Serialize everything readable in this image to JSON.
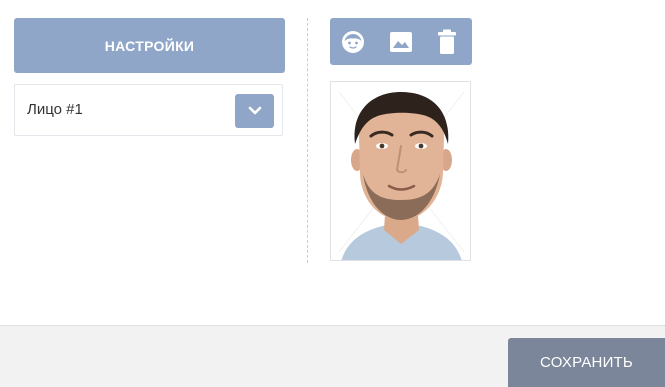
{
  "settings": {
    "label": "НАСТРОЙКИ"
  },
  "face_select": {
    "value": "Лицо #1"
  },
  "toolbar": {
    "icons": [
      "face-icon",
      "image-icon",
      "trash-icon"
    ]
  },
  "footer": {
    "save_label": "СОХРАНИТЬ"
  },
  "colors": {
    "accent": "#8fa6c8",
    "save": "#7b869a",
    "footer_bg": "#f2f2f2"
  }
}
